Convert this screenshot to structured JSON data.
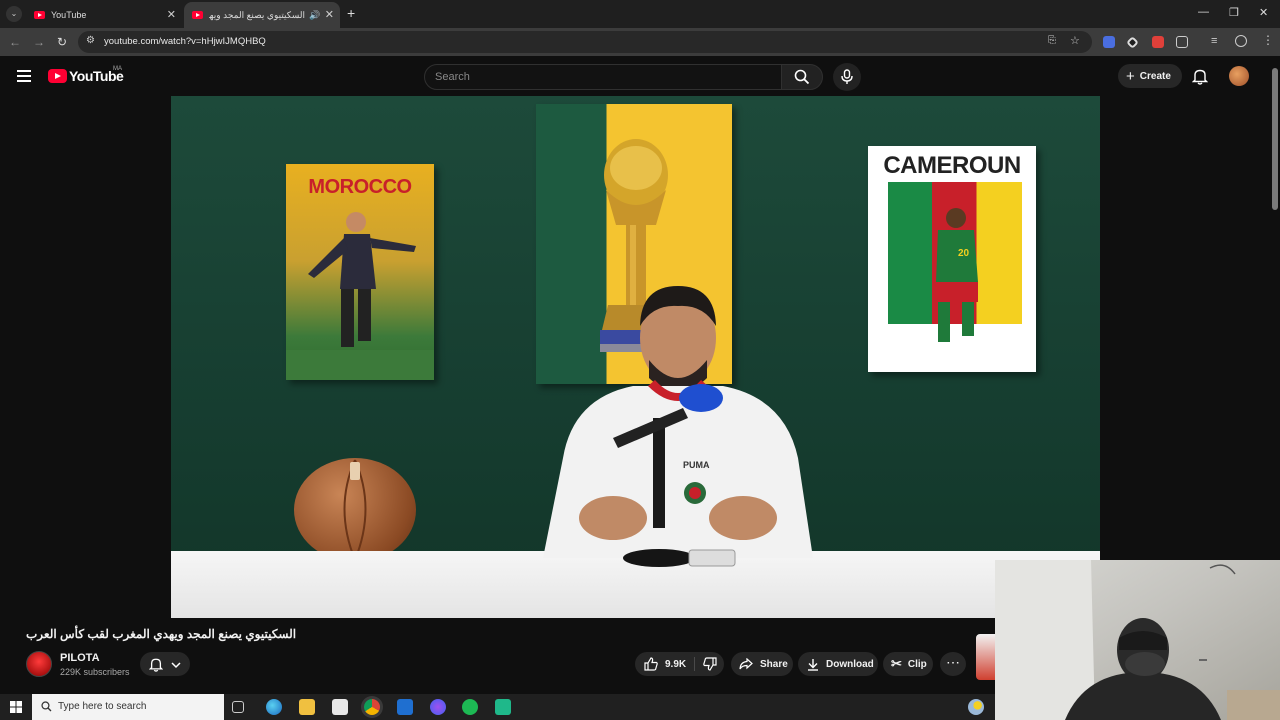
{
  "browser": {
    "tabs": [
      {
        "title": "YouTube",
        "active": false
      },
      {
        "title": "السكيتيوي يصنع المجد ويهد",
        "active": true
      }
    ],
    "new_tab": "+",
    "url": "youtube.com/watch?v=hHjwIJMQHBQ",
    "window_controls": [
      "—",
      "❐",
      "✕"
    ]
  },
  "youtube": {
    "logo_text": "YouTube",
    "country_code": "MA",
    "search_placeholder": "Search",
    "create_label": "Create"
  },
  "video_frame": {
    "poster_left": "MOROCCO",
    "poster_right": "CAMEROUN",
    "jersey_brand": "PUMA",
    "jersey_number": "20"
  },
  "video": {
    "title": "السكيتيوي يصنع المجد ويهدي المغرب لقب كأس العرب",
    "channel_name": "PILOTA",
    "subscribers": "229K subscribers",
    "likes": "9.9K",
    "share_label": "Share",
    "download_label": "Download",
    "clip_label": "Clip",
    "more_label": "⋯"
  },
  "taskbar": {
    "search_placeholder": "Type here to search"
  },
  "colors": {
    "yt_red": "#ff0033",
    "bg": "#0f0f0f",
    "pill": "#272727",
    "wall_green": "#1d4a3a"
  }
}
